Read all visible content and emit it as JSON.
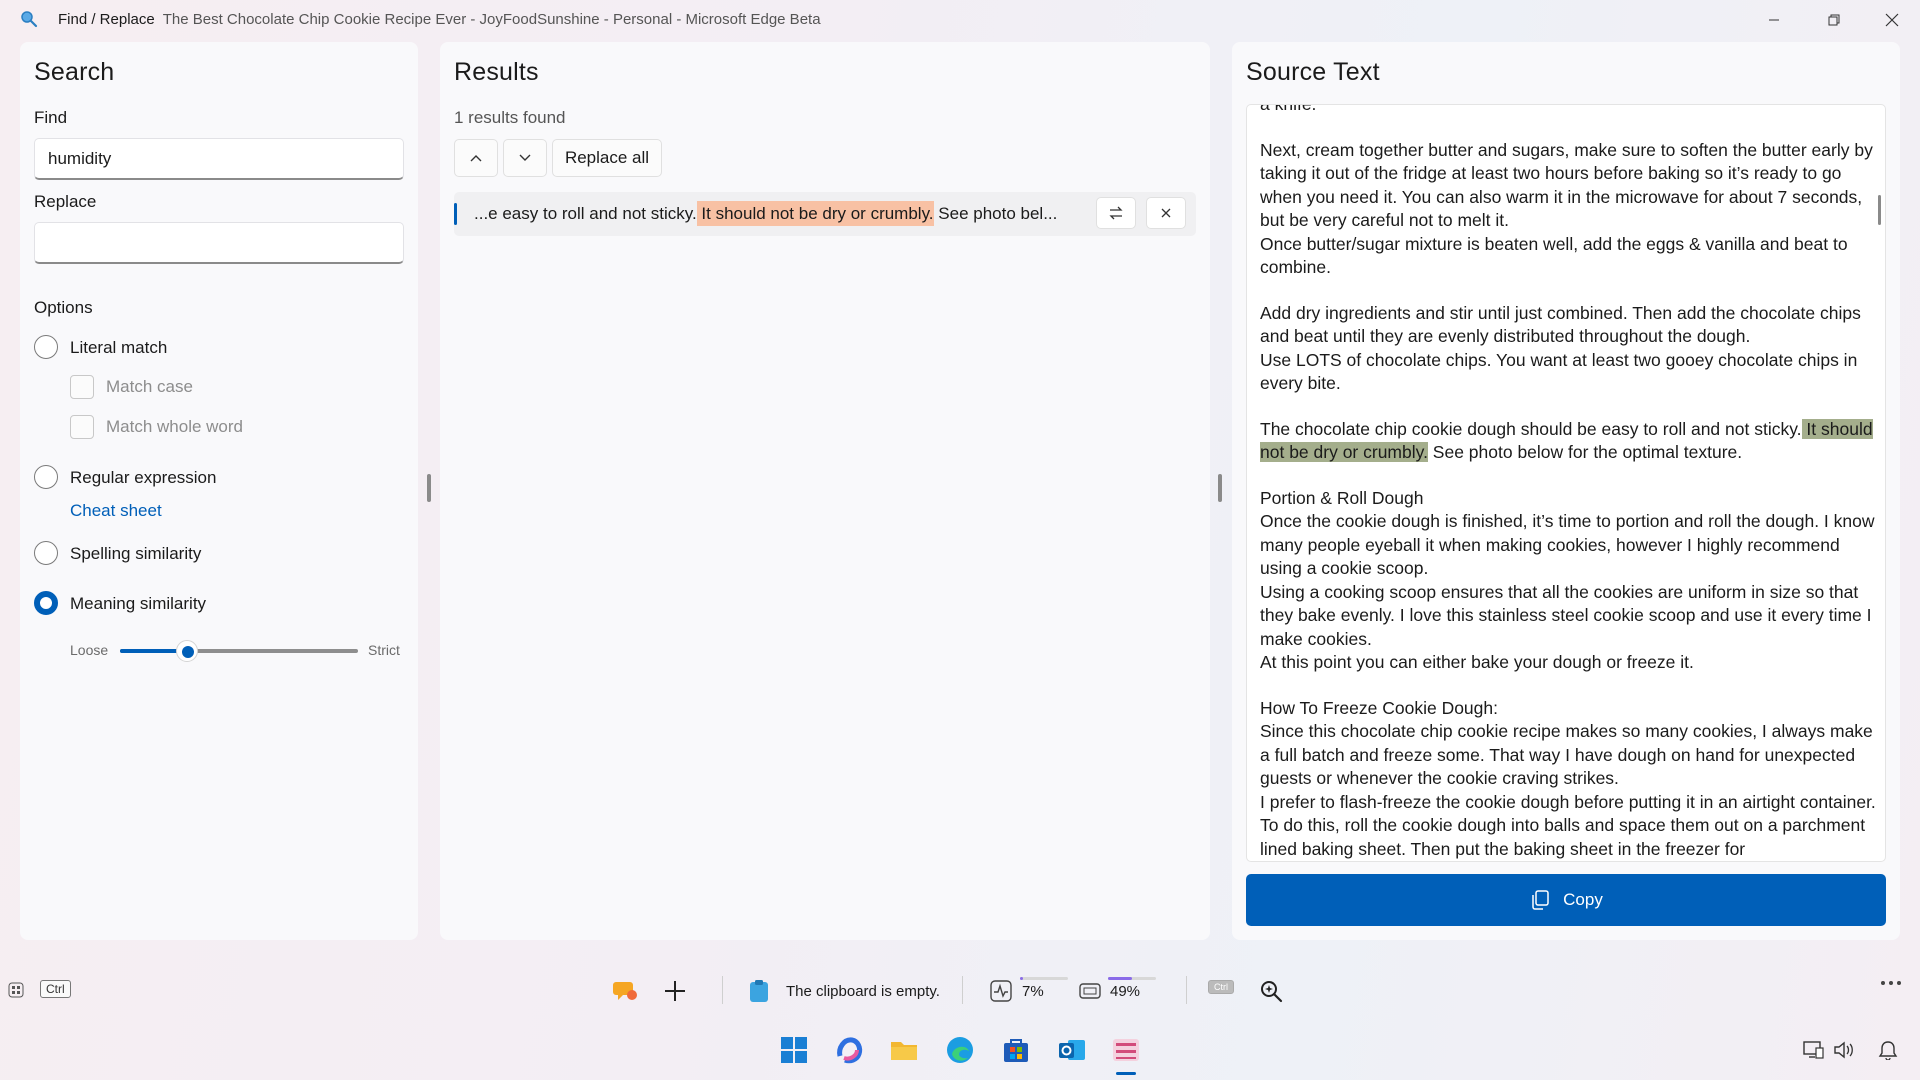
{
  "window": {
    "app_name": "Find / Replace",
    "browser_title": "The Best Chocolate Chip Cookie Recipe Ever - JoyFoodSunshine - Personal - Microsoft Edge Beta"
  },
  "search": {
    "heading": "Search",
    "find_label": "Find",
    "find_value": "humidity",
    "replace_label": "Replace",
    "replace_value": "",
    "options_label": "Options",
    "options": {
      "literal": "Literal match",
      "match_case": "Match case",
      "match_whole_word": "Match whole word",
      "regex": "Regular expression",
      "cheat_sheet": "Cheat sheet",
      "spelling": "Spelling similarity",
      "meaning": "Meaning similarity"
    },
    "selected_option": "Meaning similarity",
    "slider": {
      "min_label": "Loose",
      "max_label": "Strict",
      "value_fraction": 0.28
    }
  },
  "results": {
    "heading": "Results",
    "count_text": "1 results found",
    "replace_all_label": "Replace all",
    "items": [
      {
        "before": "...e easy to roll and not sticky.",
        "match": " It should not be dry or crumbly.",
        "after": " See photo bel..."
      }
    ]
  },
  "source": {
    "heading": "Source Text",
    "top_fragment": "a knife.",
    "paragraphs": [
      "Next, cream together butter and sugars, make sure to soften the butter early by taking it out of the fridge at least two hours before baking so it’s ready to go when you need it. You can also warm it in the microwave for about 7 seconds, but be very careful not to melt it.\nOnce butter/sugar mixture is beaten well, add the eggs & vanilla and beat to combine.",
      "Add dry ingredients and stir until just combined. Then add the chocolate chips and beat until they are evenly distributed throughout the dough.\nUse LOTS of chocolate chips. You want at least two gooey chocolate chips in every bite."
    ],
    "highlight_para": {
      "before": "The chocolate chip cookie dough should be easy to roll and not sticky.",
      "match": " It should not be dry or crumbly.",
      "after": " See photo below for the optimal texture."
    },
    "paragraphs_after": [
      "Portion & Roll Dough\nOnce the cookie dough is finished, it’s time to portion and roll the dough. I know many people eyeball it when making cookies, however I highly recommend using a cookie scoop.\nUsing a cooking scoop ensures that all the cookies are uniform in size so that they bake evenly. I love this stainless steel cookie scoop and use it every time I make cookies.\nAt this point you can either bake your dough or freeze it.",
      "How To Freeze Cookie Dough:\nSince this chocolate chip cookie recipe makes so many cookies, I always make a full batch and freeze some. That way I have dough on hand for unexpected guests or whenever the cookie craving strikes.\nI prefer to flash-freeze the cookie dough before putting it in an airtight container. To do this, roll the cookie dough into balls and space them out on a parchment lined baking sheet. Then put the baking sheet in the freezer for"
    ],
    "copy_label": "Copy"
  },
  "toolbar": {
    "ctrl_key": "Ctrl",
    "clipboard_text": "The clipboard is empty.",
    "cpu_percent": "7%",
    "memory_percent": "49%",
    "cpu_fraction": 0.07,
    "memory_fraction": 0.49,
    "mini_ctrl": "Ctrl"
  },
  "colors": {
    "accent": "#005fb8",
    "result_highlight": "#f8c1a4",
    "source_highlight": "#a4ae8c"
  }
}
